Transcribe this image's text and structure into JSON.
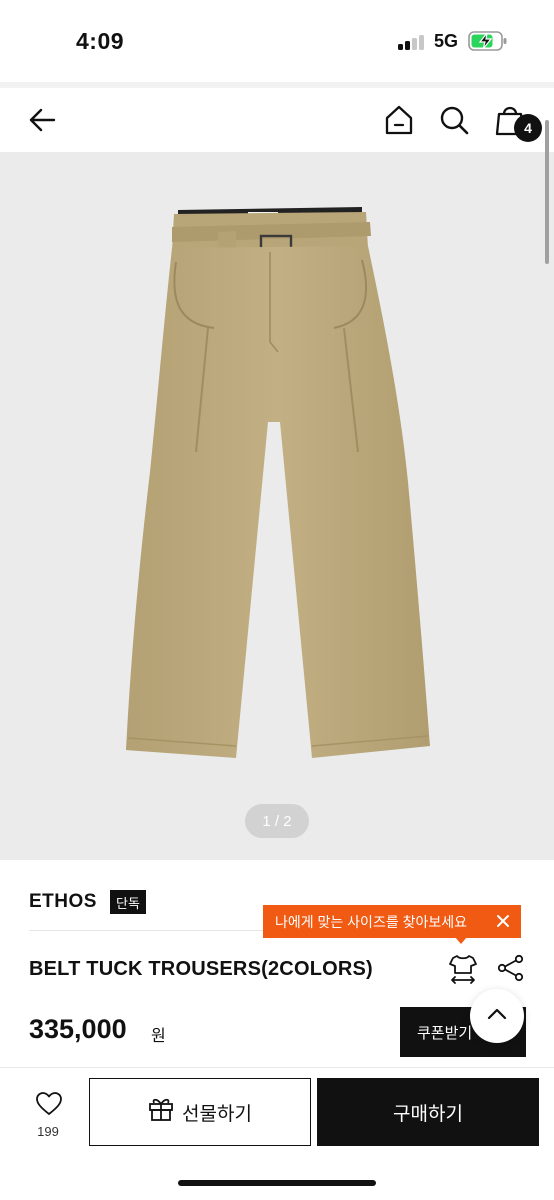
{
  "status_bar": {
    "time": "4:09",
    "network": "5G"
  },
  "header": {
    "cart_count": "4"
  },
  "gallery": {
    "indicator": "1 / 2"
  },
  "product": {
    "brand": "ETHOS",
    "exclusive_badge": "단독",
    "name": "BELT TUCK TROUSERS(2COLORS)",
    "price": "335,000",
    "currency": "원",
    "size_tip": "나에게 맞는 사이즈를 찾아보세요",
    "coupon_label": "쿠폰받기"
  },
  "bottom_bar": {
    "like_count": "199",
    "gift_label": "선물하기",
    "buy_label": "구매하기"
  },
  "colors": {
    "accent": "#f15a13",
    "product_khaki": "#bcaa7e",
    "image_bg": "#ebebeb"
  },
  "icons": [
    "back-arrow-icon",
    "home-icon",
    "search-icon",
    "shopping-bag-icon",
    "close-icon",
    "size-guide-icon",
    "share-icon",
    "chevron-up-icon",
    "heart-icon",
    "gift-icon"
  ]
}
